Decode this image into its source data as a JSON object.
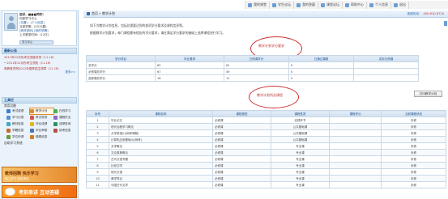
{
  "toolbar": {
    "items": [
      {
        "icon": "mail-icon",
        "label": "我的课堂"
      },
      {
        "icon": "news-icon",
        "label": "学生论坛"
      },
      {
        "icon": "chat-icon",
        "label": "我的答疑"
      },
      {
        "icon": "book-icon",
        "label": "课程论坛"
      },
      {
        "icon": "help-icon",
        "label": "帮助中心"
      },
      {
        "icon": "user-icon",
        "label": "个人信息"
      },
      {
        "icon": "exit-icon",
        "label": "退出"
      }
    ]
  },
  "profile": {
    "name": "您好，■■■同学！",
    "line2": "何家学习中心",
    "line3": "(位置)：[个人信息]",
    "line4": "当前学期：(2013春)",
    "line5": "[修改密码] [我的学籍]",
    "line6": "上次登录时间：(12日)",
    "select": "学习中心"
  },
  "notices": {
    "title": "最新公告",
    "items": [
      "2011年12月份考试进度安排（11-16）",
      "• 2011年12月份考生须知（11-16）",
      "再教育学院2012年春季招生简章（11-16）"
    ],
    "more": "更多>>"
  },
  "tools": {
    "title": "工具栏",
    "sub": "常用功能",
    "items": [
      {
        "label": "考试成绩",
        "color": "#3a7bd5",
        "icon": "score-icon"
      },
      {
        "label": "教学计划",
        "color": "#e08a2a",
        "icon": "plan-icon",
        "active": true
      },
      {
        "label": "在线学习",
        "color": "#4caf50",
        "icon": "study-icon"
      },
      {
        "label": "学习记录",
        "color": "#5a8fd0",
        "icon": "record-icon"
      },
      {
        "label": "考试安排",
        "color": "#d9534f",
        "icon": "exam-icon"
      },
      {
        "label": "课程作业",
        "color": "#8e6bbf",
        "icon": "homework-icon"
      },
      {
        "label": "教材信息",
        "color": "#3fa9c9",
        "icon": "textbook-icon"
      },
      {
        "label": "作业成绩",
        "color": "#e6b422",
        "icon": "hwscore-icon"
      },
      {
        "label": "成绩查询",
        "color": "#2f8f5f",
        "icon": "query-icon"
      },
      {
        "label": "学籍信息",
        "color": "#c76b2a",
        "icon": "roll-icon"
      },
      {
        "label": "毕业审核",
        "color": "#4c74b8",
        "icon": "grad-icon"
      },
      {
        "label": "统考信息",
        "color": "#b84c4c",
        "icon": "unified-icon"
      },
      {
        "label": "学位申请",
        "color": "#6a9e3a",
        "icon": "degree-icon"
      },
      {
        "label": "缴费信息",
        "color": "#d97a26",
        "icon": "fee-icon"
      }
    ],
    "ext": "自助学习系统"
  },
  "banner1": {
    "title": "教师招聘 快乐学习",
    "sub": "网上学习 轻松考证"
  },
  "banner2": {
    "title": "考前串讲 互动答疑"
  },
  "main": {
    "crumb_home": "首页",
    "crumb_current": "教学计划",
    "crumb_right": "客服热线：",
    "crumb_phone": "400-810-6720",
    "intro1": "如下为教学计划信息，包括总需要达到的各项学分要求及课程信息等。",
    "intro2": "根据教学计划要求，每门课程都有相应的学分要求，请在满足学分要求的基础上选择课程进行学习。",
    "circle1_label": "教学计划学分要求",
    "circle2_label": "教学计划所含课程"
  },
  "req_table": {
    "headers": [
      "学分项目",
      "毕业要求",
      "已修课学分",
      "已通过课程",
      "实际已修课"
    ],
    "rows": [
      [
        "总学分",
        "85",
        "61",
        "0",
        ""
      ],
      [
        "必修课总学分",
        "67",
        "49",
        "0",
        ""
      ],
      [
        "选修课总学分",
        "18",
        "12",
        "0",
        ""
      ]
    ]
  },
  "print_button": "打印教学计划",
  "course_table": {
    "headers": [
      "序号",
      "课程名称",
      "课程类型",
      "课程性质",
      "课程学分",
      "当前课程状态"
    ],
    "rows": [
      [
        "1",
        "毕业论文",
        "必修课",
        "实践环节",
        "",
        "未修"
      ],
      [
        "2",
        "现代远程学习概论",
        "必修课",
        "公共基础课",
        "",
        "未修"
      ],
      [
        "3",
        "大学英语(I)(网考课程)",
        "必修课",
        "公共基础课",
        "",
        "未修"
      ],
      [
        "4",
        "计算机应用基础(I)(网考)",
        "必修课",
        "公共基础课",
        "",
        "未修"
      ],
      [
        "5",
        "文学概论",
        "必修课",
        "专业课",
        "",
        "未修"
      ],
      [
        "6",
        "文论原典概论",
        "必修课",
        "专业课",
        "",
        "未修"
      ],
      [
        "7",
        "古代汉语专题",
        "必修课",
        "专业课",
        "",
        "未修"
      ],
      [
        "8",
        "比较文学",
        "必修课",
        "专业课",
        "",
        "未修"
      ],
      [
        "9",
        "现代汉语",
        "必修课",
        "专业课",
        "",
        "未修"
      ],
      [
        "10",
        "美学导论",
        "必修课",
        "专业课",
        "",
        "未修"
      ],
      [
        "11",
        "中国古代文学",
        "必修课",
        "专业课",
        "",
        "未修"
      ]
    ]
  }
}
